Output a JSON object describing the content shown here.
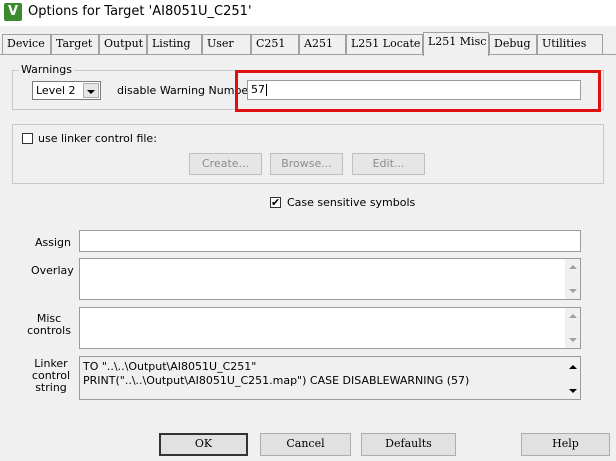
{
  "window": {
    "title": "Options for Target 'AI8051U_C251'",
    "icon_char": "V"
  },
  "tabs": [
    "Device",
    "Target",
    "Output",
    "Listing",
    "User",
    "C251",
    "A251",
    "L251 Locate",
    "L251 Misc",
    "Debug",
    "Utilities"
  ],
  "active_tab": "L251 Misc",
  "warnings": {
    "group_label": "Warnings",
    "level_selected": "Level 2",
    "disable_label": "disable Warning Numbers:",
    "disable_value": "57"
  },
  "linker_control": {
    "checkbox_label": "use linker control file:",
    "checked": false,
    "create_label": "Create...",
    "browse_label": "Browse...",
    "edit_label": "Edit..."
  },
  "case_sensitive": {
    "label": "Case sensitive symbols",
    "checked": true
  },
  "fields": {
    "assign_label": "Assign",
    "overlay_label": "Overlay",
    "misc_label_1": "Misc",
    "misc_label_2": "controls",
    "linker_label_1": "Linker",
    "linker_label_2": "control",
    "linker_label_3": "string",
    "linker_string_line1": "TO \"..\\..\\Output\\AI8051U_C251\"",
    "linker_string_line2": "PRINT(\"..\\..\\Output\\AI8051U_C251.map\") CASE DISABLEWARNING (57)"
  },
  "buttons": {
    "ok": "OK",
    "cancel": "Cancel",
    "defaults": "Defaults",
    "help": "Help"
  },
  "colors": {
    "highlight": "#e01010",
    "icon_bg": "#3b8a2e"
  }
}
